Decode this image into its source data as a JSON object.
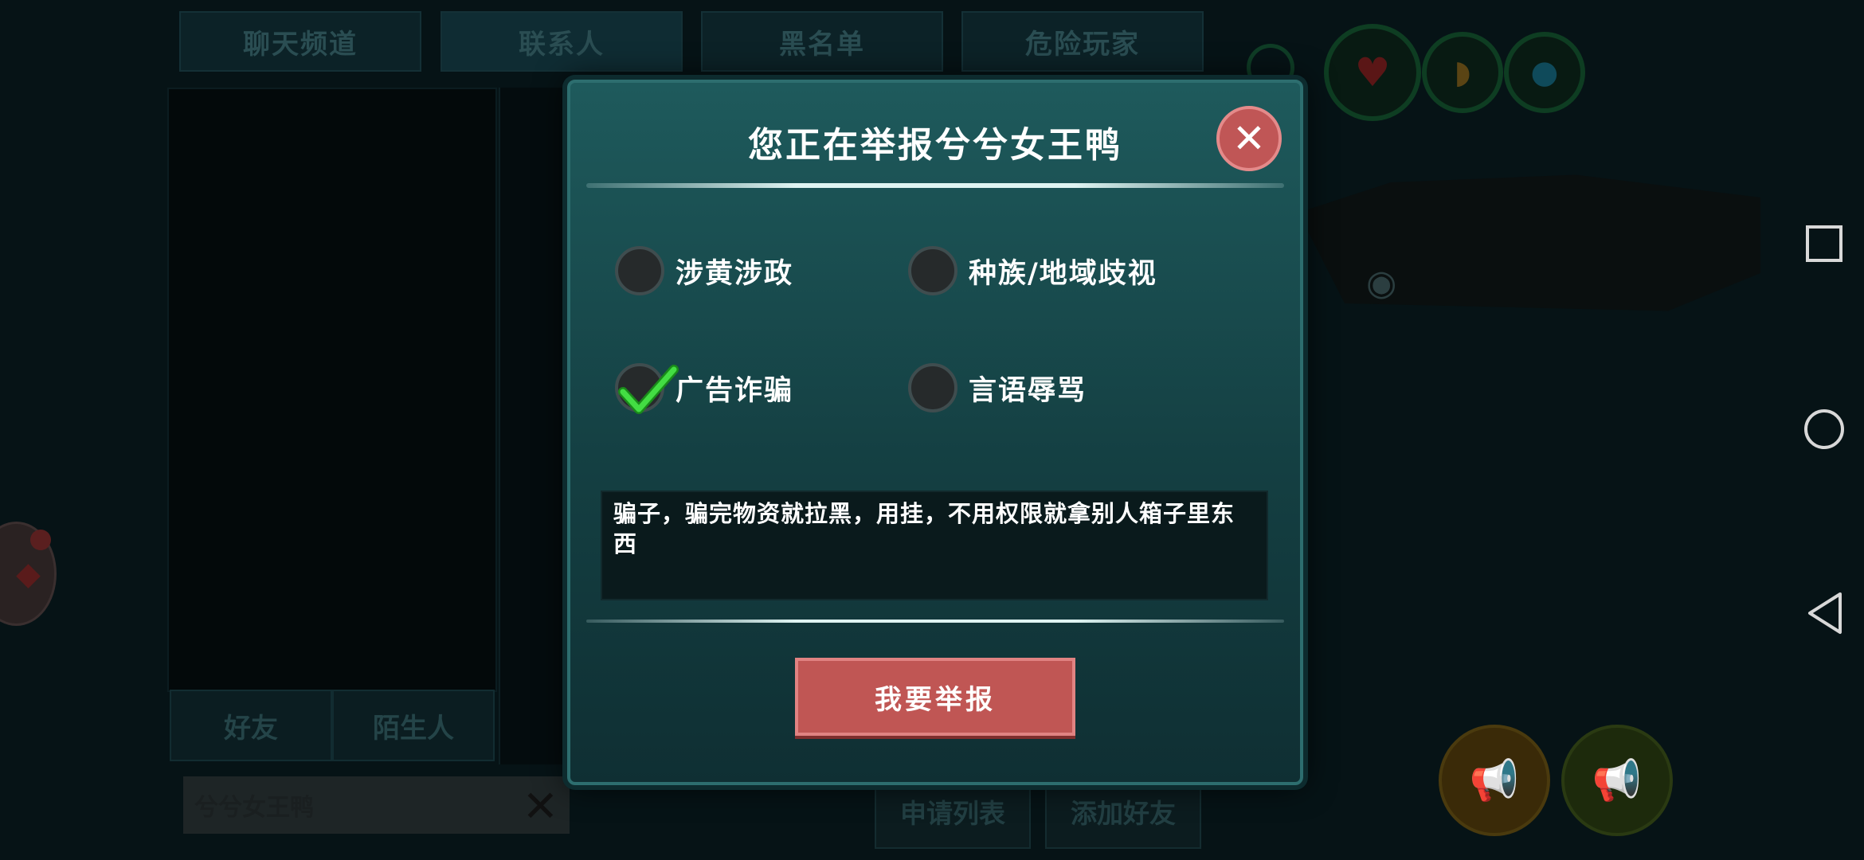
{
  "background": {
    "top_tabs": [
      "聊天频道",
      "联系人",
      "黑名单",
      "危险玩家"
    ],
    "sub_tabs": [
      "好友",
      "陌生人"
    ],
    "name_field_value": "兮兮女王鸭",
    "bottom_buttons": [
      "申请列表",
      "添加好友"
    ]
  },
  "modal": {
    "title": "您正在举报兮兮女王鸭",
    "options": [
      {
        "label": "涉黄涉政",
        "checked": false
      },
      {
        "label": "种族/地域歧视",
        "checked": false
      },
      {
        "label": "广告诈骗",
        "checked": true
      },
      {
        "label": "言语辱骂",
        "checked": false
      }
    ],
    "description": "骗子，骗完物资就拉黑，用挂，不用权限就拿别人箱子里东西",
    "submit_label": "我要举报"
  },
  "colors": {
    "modal_bg": "#1e5a5c",
    "accent_red": "#c05654",
    "check_green": "#3dd63d"
  },
  "icons": [
    "close-icon",
    "check-icon",
    "heart-icon",
    "drumstick-icon",
    "water-drop-icon",
    "eye-icon",
    "megaphone-icon",
    "square-icon",
    "circle-icon",
    "back-triangle-icon"
  ]
}
